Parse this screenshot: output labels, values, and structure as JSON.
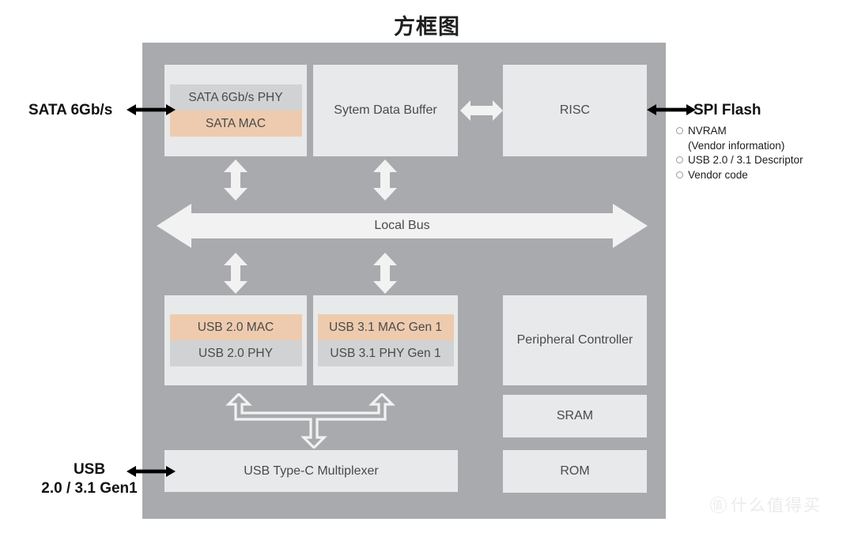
{
  "title": "方框图",
  "panel": {
    "background": "#a8aaad"
  },
  "colors": {
    "panel_gray": "#a8aaad",
    "block_light": "#e8e9ea",
    "phy_gray": "#d1d2d4",
    "mac_peach": "#eecbae",
    "arrow_white": "#f2f2f2",
    "text_dark": "#4a4a4a",
    "label_black": "#111111"
  },
  "blocks": {
    "sata": {
      "phy_label": "SATA 6Gb/s PHY",
      "mac_label": "SATA MAC"
    },
    "data_buffer": {
      "label": "Sytem Data Buffer"
    },
    "risc": {
      "label": "RISC"
    },
    "local_bus": {
      "label": "Local Bus"
    },
    "usb20": {
      "mac_label": "USB 2.0 MAC",
      "phy_label": "USB 2.0 PHY"
    },
    "usb31": {
      "mac_label": "USB 3.1 MAC Gen 1",
      "phy_label": "USB 3.1 PHY Gen 1"
    },
    "peripheral": {
      "label": "Peripheral Controller"
    },
    "sram": {
      "label": "SRAM"
    },
    "rom": {
      "label": "ROM"
    },
    "typec": {
      "label": "USB Type-C Multiplexer"
    }
  },
  "external": {
    "sata": {
      "label": "SATA 6Gb/s"
    },
    "usb": {
      "line1": "USB",
      "line2": "2.0 / 3.1 Gen1"
    },
    "spi": {
      "label": "SPI Flash",
      "items": [
        {
          "text": "NVRAM",
          "sub": "(Vendor information)"
        },
        {
          "text": "USB 2.0 / 3.1 Descriptor",
          "sub": ""
        },
        {
          "text": "Vendor code",
          "sub": ""
        }
      ]
    }
  },
  "watermark": {
    "mark": "值",
    "text": "什么值得买"
  }
}
